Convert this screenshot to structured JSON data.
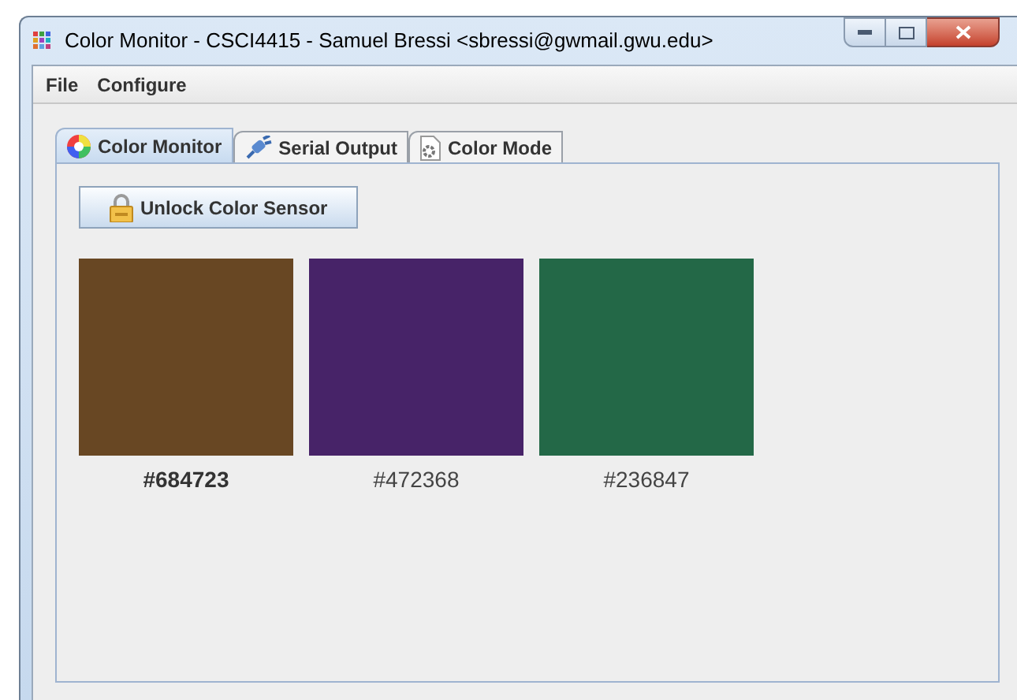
{
  "window": {
    "title": "Color Monitor - CSCI4415 - Samuel Bressi <sbressi@gwmail.gwu.edu>"
  },
  "menu": [
    "File",
    "Configure"
  ],
  "tabs": [
    {
      "label": "Color Monitor",
      "selected": true,
      "kind": "wheel"
    },
    {
      "label": "Serial Output",
      "selected": false,
      "kind": "plug"
    },
    {
      "label": "Color Mode",
      "selected": false,
      "kind": "gear"
    }
  ],
  "unlock_button": {
    "label": "Unlock Color Sensor"
  },
  "swatches": [
    {
      "color": "#684723",
      "label": "#684723",
      "selected": true
    },
    {
      "color": "#472368",
      "label": "#472368",
      "selected": false
    },
    {
      "color": "#236847",
      "label": "#236847",
      "selected": false
    }
  ]
}
